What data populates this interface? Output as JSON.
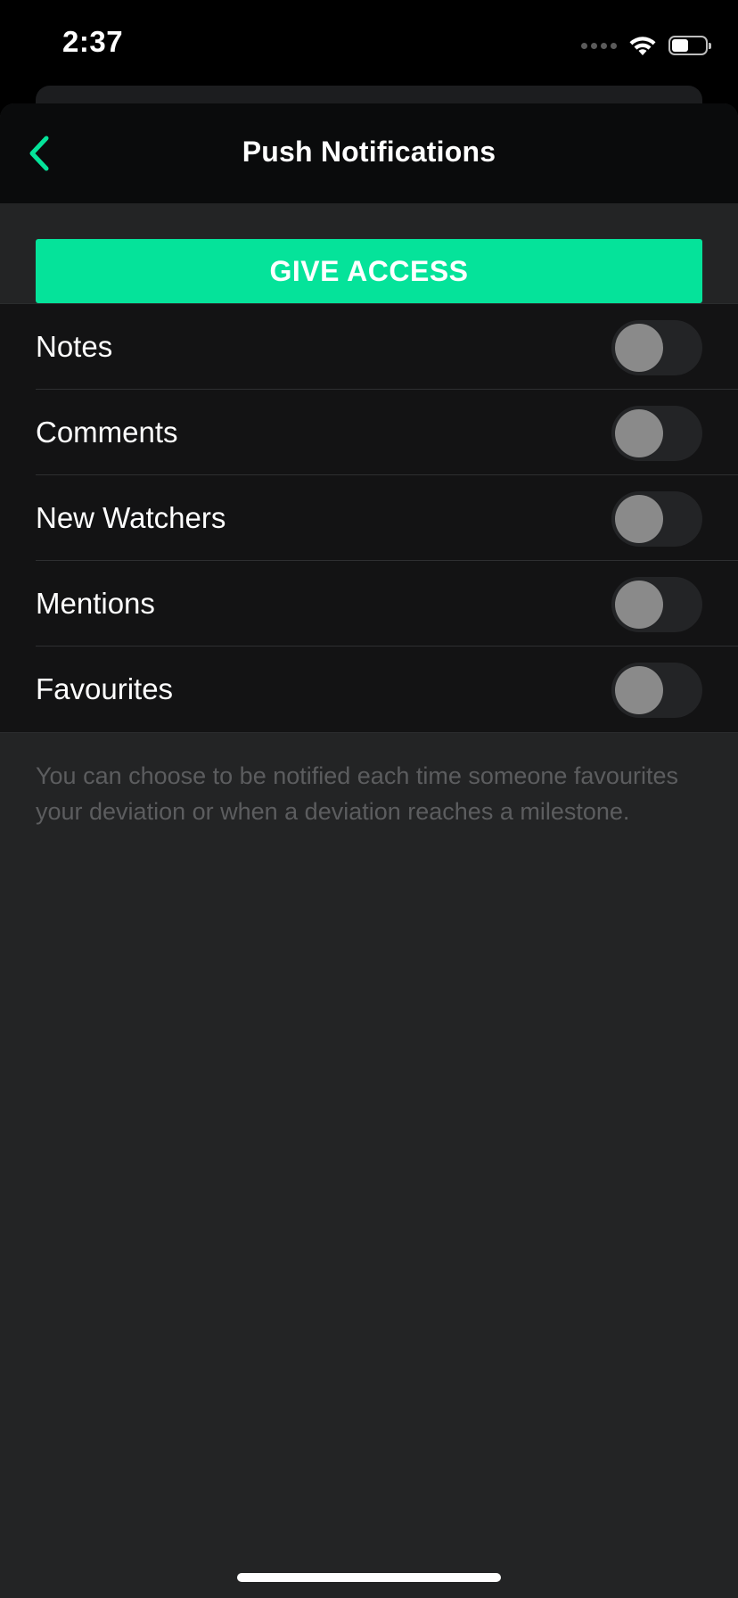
{
  "status_bar": {
    "time": "2:37",
    "icons": [
      "signal-dots-icon",
      "wifi-icon",
      "battery-icon"
    ]
  },
  "header": {
    "title": "Push Notifications",
    "back_icon": "chevron-left-icon"
  },
  "access": {
    "button_label": "GIVE ACCESS"
  },
  "settings": {
    "items": [
      {
        "label": "Notes",
        "enabled": false
      },
      {
        "label": "Comments",
        "enabled": false
      },
      {
        "label": "New Watchers",
        "enabled": false
      },
      {
        "label": "Mentions",
        "enabled": false
      },
      {
        "label": "Favourites",
        "enabled": false
      }
    ]
  },
  "footer": {
    "description": "You can choose to be notified each time someone favourites your deviation or when a deviation reaches a milestone."
  },
  "colors": {
    "accent": "#05e39a",
    "background": "#232425",
    "header": "#0a0b0c",
    "list": "#131314",
    "toggle_off_knob": "#8a8a8a"
  }
}
